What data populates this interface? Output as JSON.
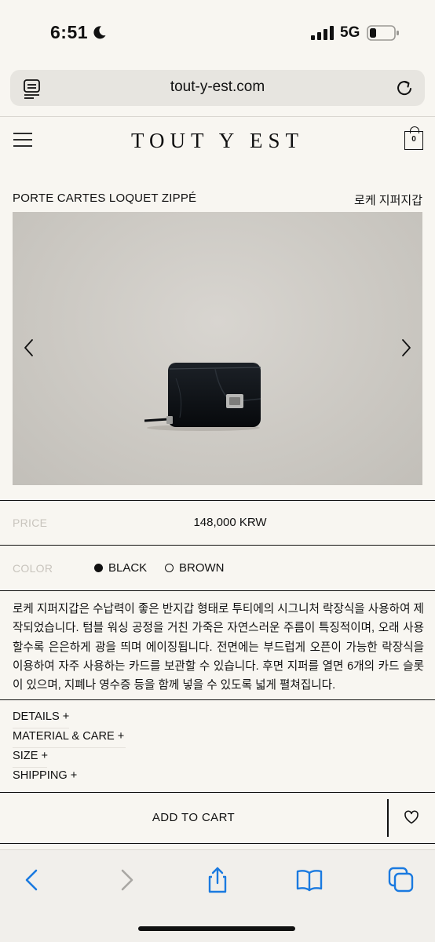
{
  "status_bar": {
    "time": "6:51",
    "network": "5G",
    "icons": [
      "moon-icon",
      "signal-icon",
      "battery-icon"
    ]
  },
  "browser": {
    "url": "tout-y-est.com",
    "icons": [
      "reader-icon",
      "reload-icon"
    ]
  },
  "site": {
    "brand": "TOUT Y EST",
    "cart_count": "0",
    "icons": [
      "menu-icon",
      "shopping-bag-icon"
    ]
  },
  "product": {
    "name_en": "PORTE CARTES LOQUET ZIPPÉ",
    "name_ko": "로케 지퍼지갑",
    "price_label": "PRICE",
    "price": "148,000 KRW",
    "color_label": "COLOR",
    "colors": [
      {
        "label": "BLACK",
        "selected": true
      },
      {
        "label": "BROWN",
        "selected": false
      }
    ],
    "description": "로케 지퍼지갑은 수납력이 좋은 반지갑 형태로 투티에의 시그니처 락장식을 사용하여 제작되었습니다. 텀블 워싱 공정을 거친 가죽은 자연스러운 주름이 특징적이며, 오래 사용할수록 은은하게 광을 띄며 에이징됩니다. 전면에는 부드럽게 오픈이 가능한 락장식을 이용하여 자주 사용하는 카드를 보관할 수 있습니다. 후면 지퍼를 열면 6개의 카드 슬롯이 있으며, 지폐나 영수증 등을 함께 넣을 수 있도록 넓게 펼쳐집니다."
  },
  "accordions": [
    {
      "label": "DETAILS +"
    },
    {
      "label": "MATERIAL & CARE +"
    },
    {
      "label": "SIZE +"
    },
    {
      "label": "SHIPPING +"
    }
  ],
  "actions": {
    "add_to_cart": "ADD TO CART",
    "wishlist_icon": "heart-icon"
  },
  "toolbar": {
    "icons": [
      "back-icon",
      "forward-icon",
      "share-icon",
      "bookmarks-icon",
      "tabs-icon"
    ]
  },
  "colors": {
    "background": "#f8f6f1",
    "text": "#111111",
    "muted_label": "#c8c4bd",
    "url_bar": "#e7e5e0",
    "accent_blue": "#1a7ae0"
  }
}
